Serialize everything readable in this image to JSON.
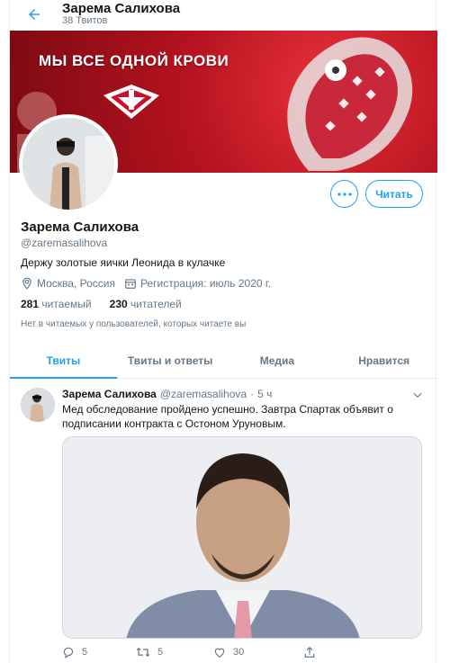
{
  "header": {
    "title": "Зарема Салихова",
    "tweet_count": "38 Твитов"
  },
  "banner": {
    "slogan": "МЫ ВСЕ ОДНОЙ КРОВИ"
  },
  "profile": {
    "name": "Зарема Салихова",
    "handle": "@zaremasalihova",
    "bio": "Держу золотые яички Леонида в кулачке",
    "location": "Москва, Россия",
    "joined": "Регистрация: июль 2020 г.",
    "following_count": "281",
    "following_label": "читаемый",
    "followers_count": "230",
    "followers_label": "читателей",
    "mutual_note": "Нет в читаемых у пользователей, которых читаете вы"
  },
  "buttons": {
    "follow": "Читать",
    "more_icon": "ellipsis-icon"
  },
  "tabs": [
    {
      "label": "Твиты",
      "active": true
    },
    {
      "label": "Твиты и ответы",
      "active": false
    },
    {
      "label": "Медиа",
      "active": false
    },
    {
      "label": "Нравится",
      "active": false
    }
  ],
  "tweet": {
    "name": "Зарема Салихова",
    "handle": "@zaremasalihova",
    "separator": "·",
    "time": "5 ч",
    "text": "Мед обследование пройдено успешно. Завтра Спартак объявит о подписании контракта с Остоном Уруновым.",
    "replies": "5",
    "retweets": "5",
    "likes": "30"
  },
  "colors": {
    "accent": "#1da1f2",
    "muted": "#657786",
    "banner": "#b4121e"
  }
}
